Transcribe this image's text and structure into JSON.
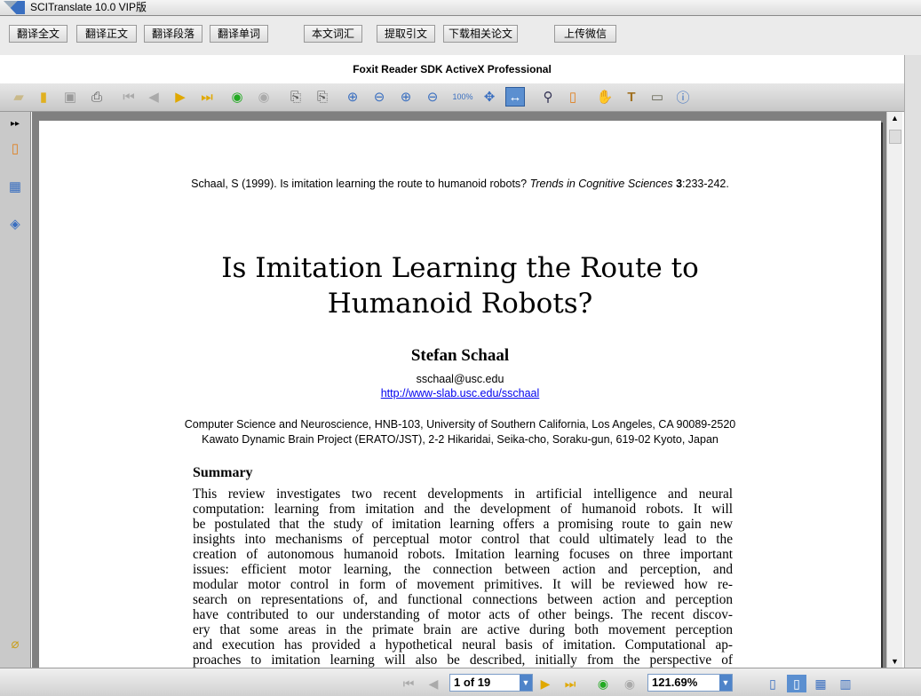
{
  "app": {
    "title": "SCITranslate 10.0 VIP版"
  },
  "topbar": {
    "buttons": [
      "翻译全文",
      "翻译正文",
      "翻译段落",
      "翻译单词",
      "本文词汇",
      "提取引文",
      "下载相关论文",
      "上传微信"
    ]
  },
  "viewer": {
    "title": "Foxit Reader SDK ActiveX Professional"
  },
  "toolbar": {
    "icons": [
      "open-folder-icon",
      "open-file-icon",
      "save-icon",
      "print-icon",
      "first-page-icon",
      "prev-page-icon",
      "next-page-icon",
      "last-page-icon",
      "back-icon",
      "forward-icon",
      "rotate-left-icon",
      "rotate-right-icon",
      "zoom-in-icon",
      "zoom-out-icon",
      "zoom-in-small-icon",
      "zoom-out-small-icon",
      "actual-size-icon",
      "fit-page-icon",
      "fit-width-icon",
      "find-icon",
      "bookmark-icon",
      "hand-tool-icon",
      "text-select-icon",
      "snapshot-icon",
      "info-icon"
    ],
    "active": "fit-width-icon"
  },
  "document": {
    "citation_prefix": "Schaal, S (1999). Is imitation learning the route to humanoid robots? ",
    "citation_journal": "Trends in Cognitive Sciences",
    "citation_volume": "3",
    "citation_pages": ":233-242.",
    "title_line1": "Is Imitation Learning the Route to",
    "title_line2": "Humanoid Robots?",
    "author": "Stefan Schaal",
    "email": "sschaal@usc.edu",
    "url": "http://www-slab.usc.edu/sschaal",
    "affiliation1": "Computer Science and Neuroscience, HNB-103, University of Southern California, Los Angeles, CA 90089-2520",
    "affiliation2": "Kawato Dynamic Brain Project (ERATO/JST), 2-2 Hikaridai, Seika-cho, Soraku-gun, 619-02 Kyoto, Japan",
    "summary_heading": "Summary",
    "summary_lines": [
      "This review investigates two recent developments in artificial intelligence and neural",
      "computation: learning from imitation and the development of humanoid robots. It will",
      "be postulated that the study of imitation learning offers a promising route to gain new",
      "insights into mechanisms of perceptual motor control that could ultimately lead to the",
      "creation of autonomous humanoid robots. Imitation learning focuses on three important",
      "issues: efficient motor learning, the connection between action and perception, and",
      "modular motor control in form of movement primitives. It will be reviewed how re-",
      "search on representations of, and functional connections between action and perception",
      "have contributed to our understanding of motor acts of other beings. The recent discov-",
      "ery that some areas in the primate brain are active during both movement perception",
      "and execution has provided a hypothetical neural basis of imitation. Computational ap-",
      "proaches to imitation learning will also be described, initially from the perspective of"
    ]
  },
  "status": {
    "page": "1 of 19",
    "zoom": "121.69%"
  }
}
